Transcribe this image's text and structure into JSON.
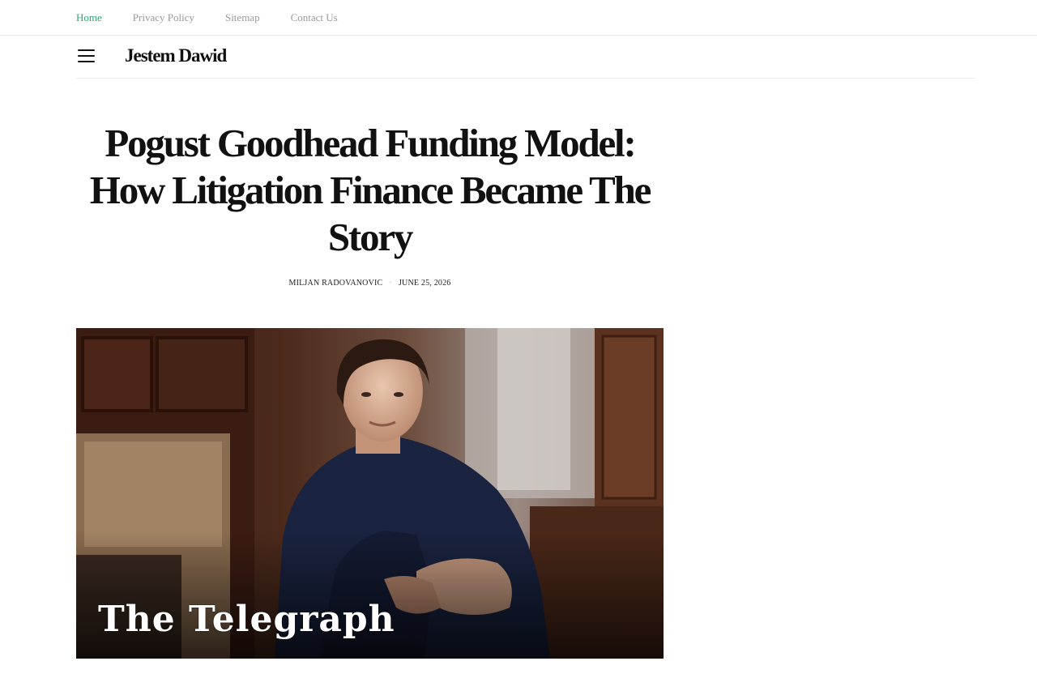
{
  "topnav": {
    "items": [
      {
        "label": "Home",
        "active": true
      },
      {
        "label": "Privacy Policy",
        "active": false
      },
      {
        "label": "Sitemap",
        "active": false
      },
      {
        "label": "Contact Us",
        "active": false
      }
    ],
    "active_color": "#2aa876",
    "inactive_color": "#9a9a9a"
  },
  "header": {
    "menu_icon": "hamburger-menu-icon",
    "site_title": "Jestem Dawid"
  },
  "article": {
    "title": "Pogust Goodhead Funding Model: How Litigation Finance Became The Story",
    "author": "MILJAN RADOVANOVIC",
    "separator": "·",
    "date": "JUNE 25, 2026"
  },
  "featured_image": {
    "logo_text": "The Telegraph"
  }
}
